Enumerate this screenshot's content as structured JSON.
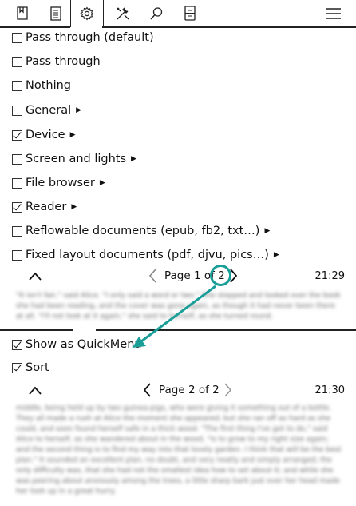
{
  "tabs": [
    {
      "icon": "bookmark-icon"
    },
    {
      "icon": "document-icon"
    },
    {
      "icon": "gear-icon"
    },
    {
      "icon": "tools-icon"
    },
    {
      "icon": "search-icon"
    },
    {
      "icon": "device-icon"
    },
    {
      "icon": "hamburger-menu-icon"
    }
  ],
  "menu1": {
    "items": [
      {
        "label": "Pass through (default)",
        "checked": false
      },
      {
        "label": "Pass through",
        "checked": false
      },
      {
        "label": "Nothing",
        "checked": false
      },
      {
        "label": "General",
        "checked": false,
        "submenu": true
      },
      {
        "label": "Device",
        "checked": true,
        "submenu": true
      },
      {
        "label": "Screen and lights",
        "checked": false,
        "submenu": true
      },
      {
        "label": "File browser",
        "checked": false,
        "submenu": true
      },
      {
        "label": "Reader",
        "checked": true,
        "submenu": true
      },
      {
        "label": "Reflowable documents (epub, fb2, txt…)",
        "checked": false,
        "submenu": true
      },
      {
        "label": "Fixed layout documents (pdf, djvu, pics…)",
        "checked": false,
        "submenu": true
      }
    ],
    "page": "Page 1 of 2",
    "clock": "21:29"
  },
  "book_text_top": "\"It isn't fair,\" said Alice. \"I only said a word or two.\" She stopped and looked over the book she had been reading, and the cover was gone again, as though it had never been there at all. \"I'll not look at it again,\" she said to herself, as she turned round.",
  "menu2": {
    "items": [
      {
        "label": "Show as QuickMenu",
        "checked": true
      },
      {
        "label": "Sort",
        "checked": true
      }
    ],
    "page": "Page 2 of 2",
    "clock": "21:30"
  },
  "book_text_bottom": "middle, being held up by two guinea-pigs, who were giving it something out of a bottle. They all made a rush at Alice the moment she appeared; but she ran off as hard as she could, and soon found herself safe in a thick wood. \"The first thing I've got to do,\" said Alice to herself, as she wandered about in the wood, \"is to grow to my right size again; and the second thing is to find my way into that lovely garden. I think that will be the best plan.\" It sounded an excellent plan, no doubt, and very neatly and simply arranged; the only difficulty was, that she had not the smallest idea how to set about it; and while she was peering about anxiously among the trees, a little sharp bark just over her head made her look up in a great hurry.",
  "colors": {
    "accent": "#1a9e98"
  }
}
